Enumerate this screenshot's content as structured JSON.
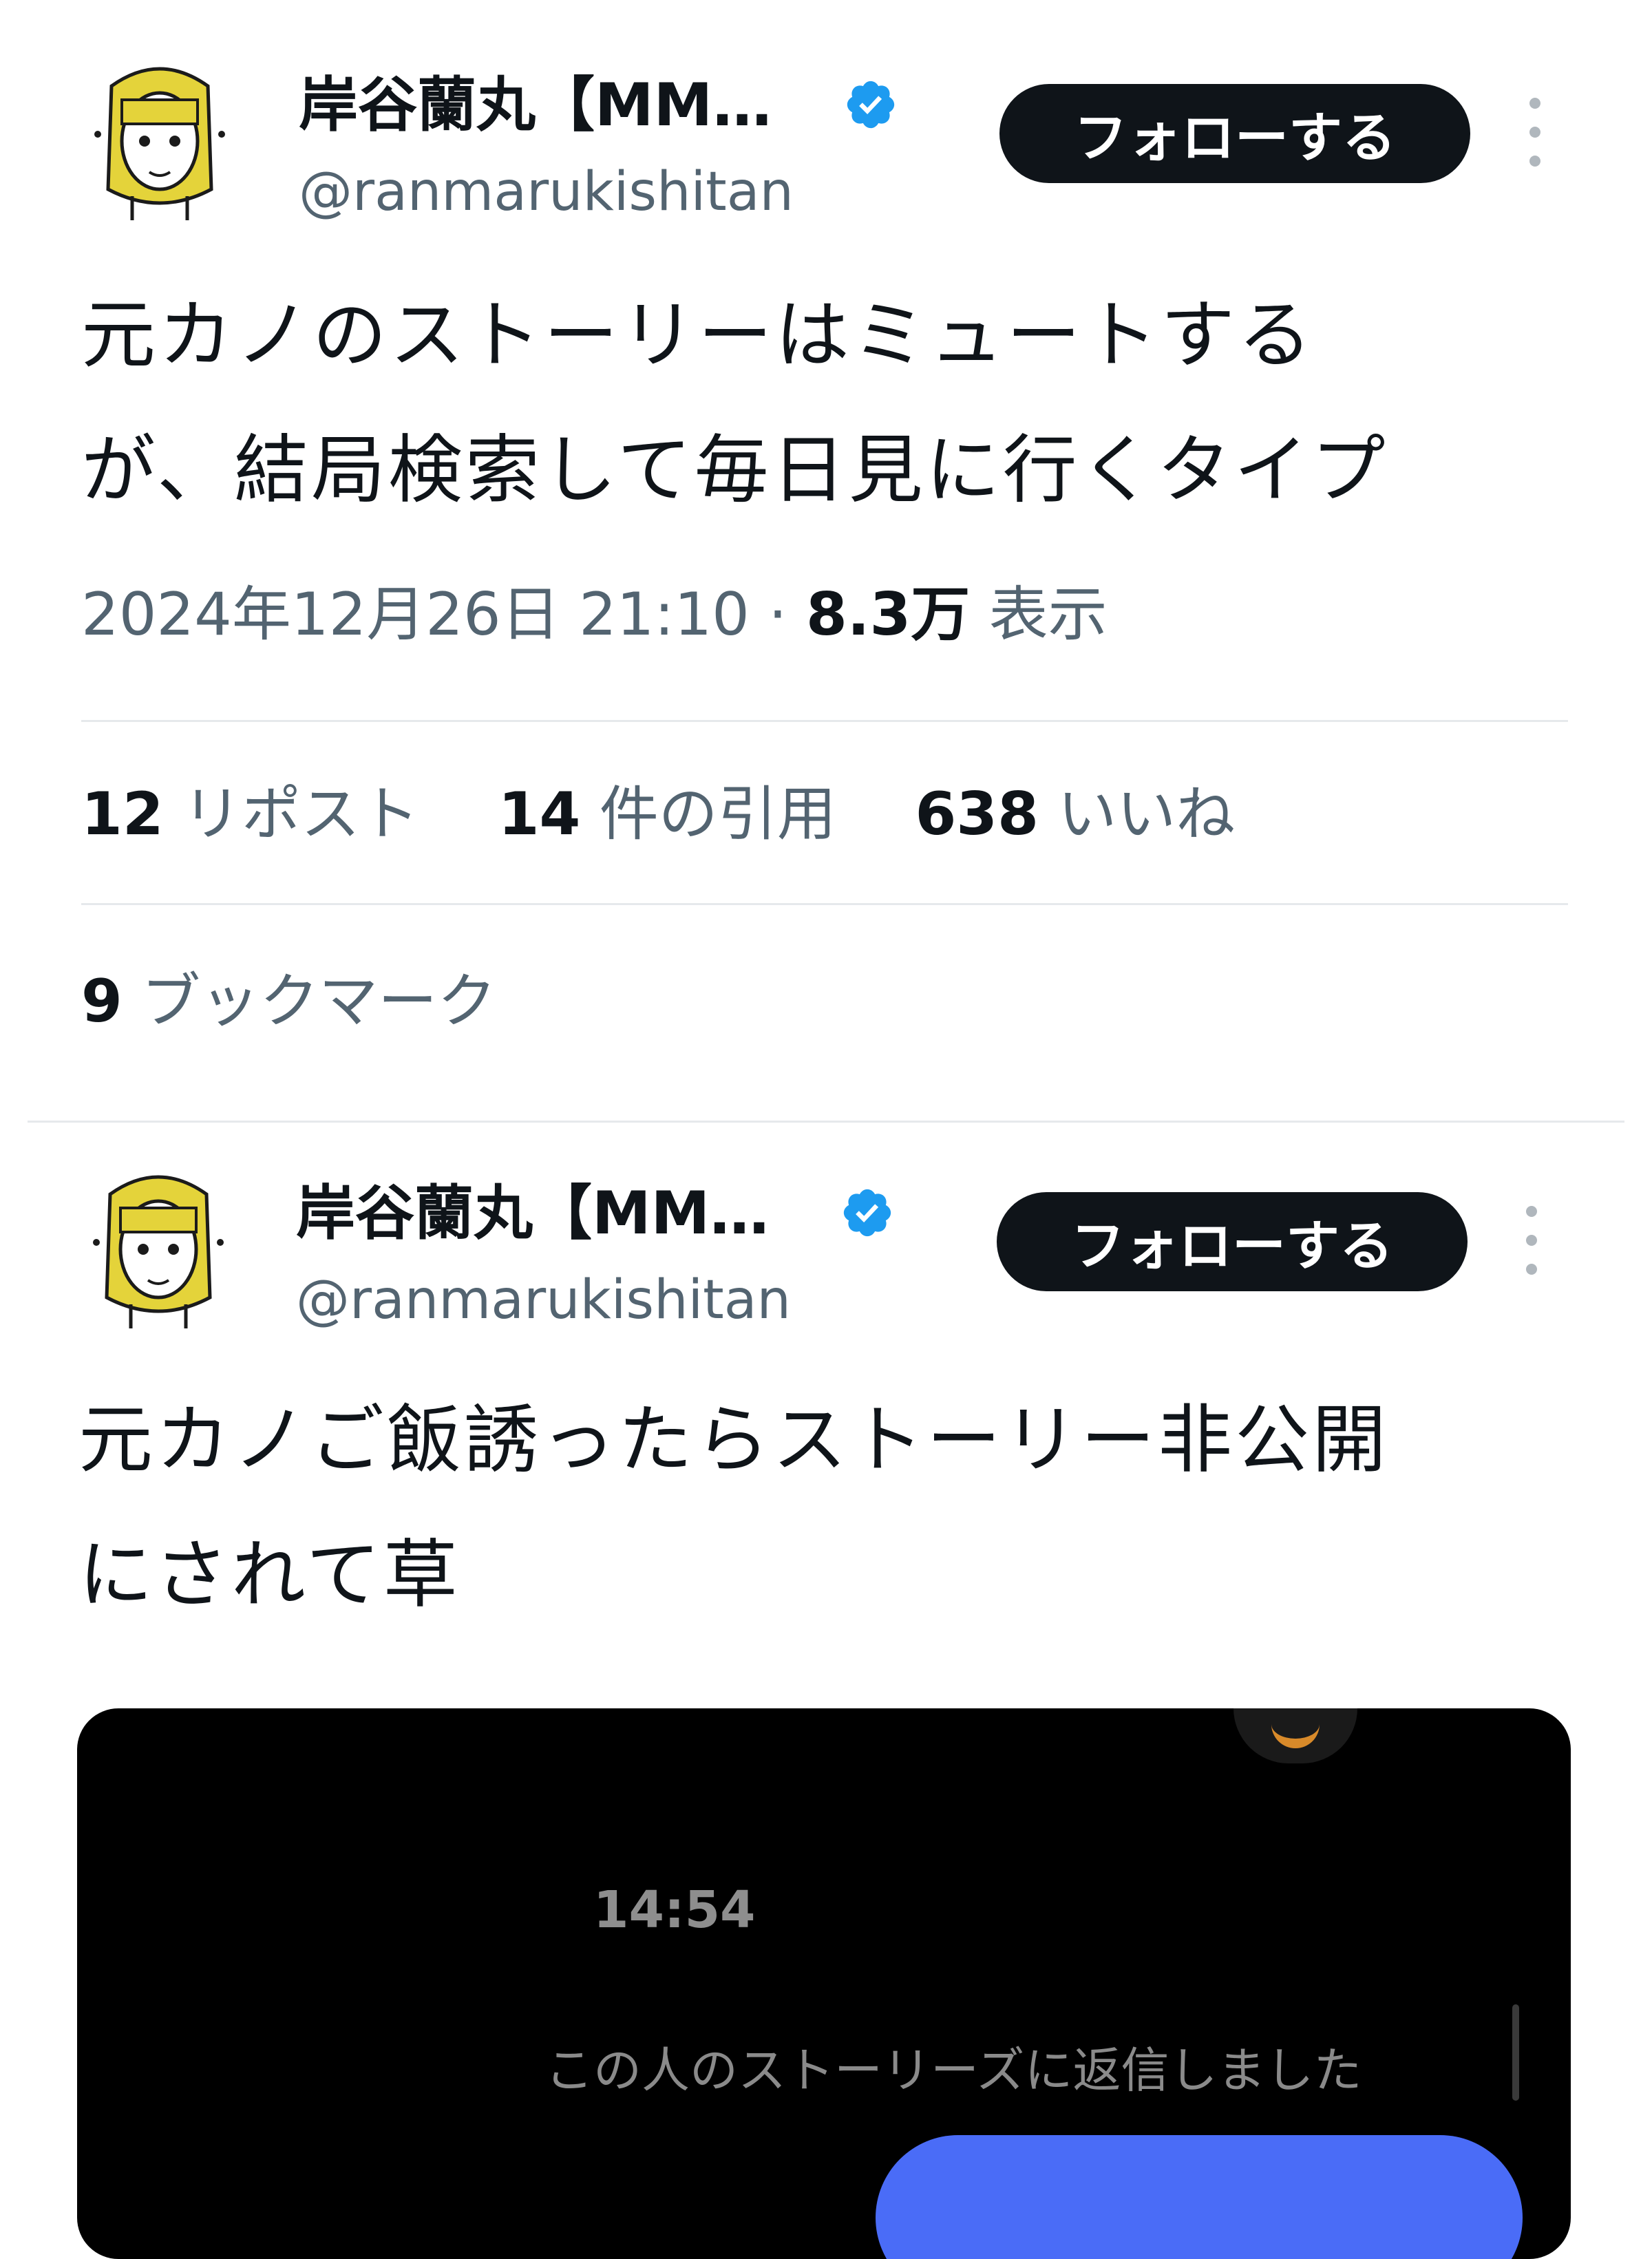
{
  "tweet1": {
    "display_name": "岸谷蘭丸【MM…",
    "handle": "@ranmarukishitan",
    "follow_label": "フォローする",
    "body": "元カノのストーリーはミュートする\nが、結局検索して毎日見に行くタイプ",
    "timestamp": "2024年12月26日 21:10",
    "separator": "·",
    "views_count": "8.3万",
    "views_label": "表示",
    "reposts_count": "12",
    "reposts_label": "リポスト",
    "quotes_count": "14",
    "quotes_label": "件の引用",
    "likes_count": "638",
    "likes_label": "いいね",
    "bookmarks_count": "9",
    "bookmarks_label": "ブックマーク"
  },
  "tweet2": {
    "display_name": "岸谷蘭丸【MM…",
    "handle": "@ranmarukishitan",
    "follow_label": "フォローする",
    "body": "元カノご飯誘ったらストーリー非公開\nにされて草",
    "media": {
      "time": "14:54",
      "note": "この人のストーリーズに返信しました"
    }
  },
  "colors": {
    "verified": "#1d9bf0",
    "follow_button": "#0f1419",
    "secondary_text": "#536471"
  },
  "icons": [
    "avatar",
    "verified-badge-icon",
    "more-vertical-icon"
  ]
}
